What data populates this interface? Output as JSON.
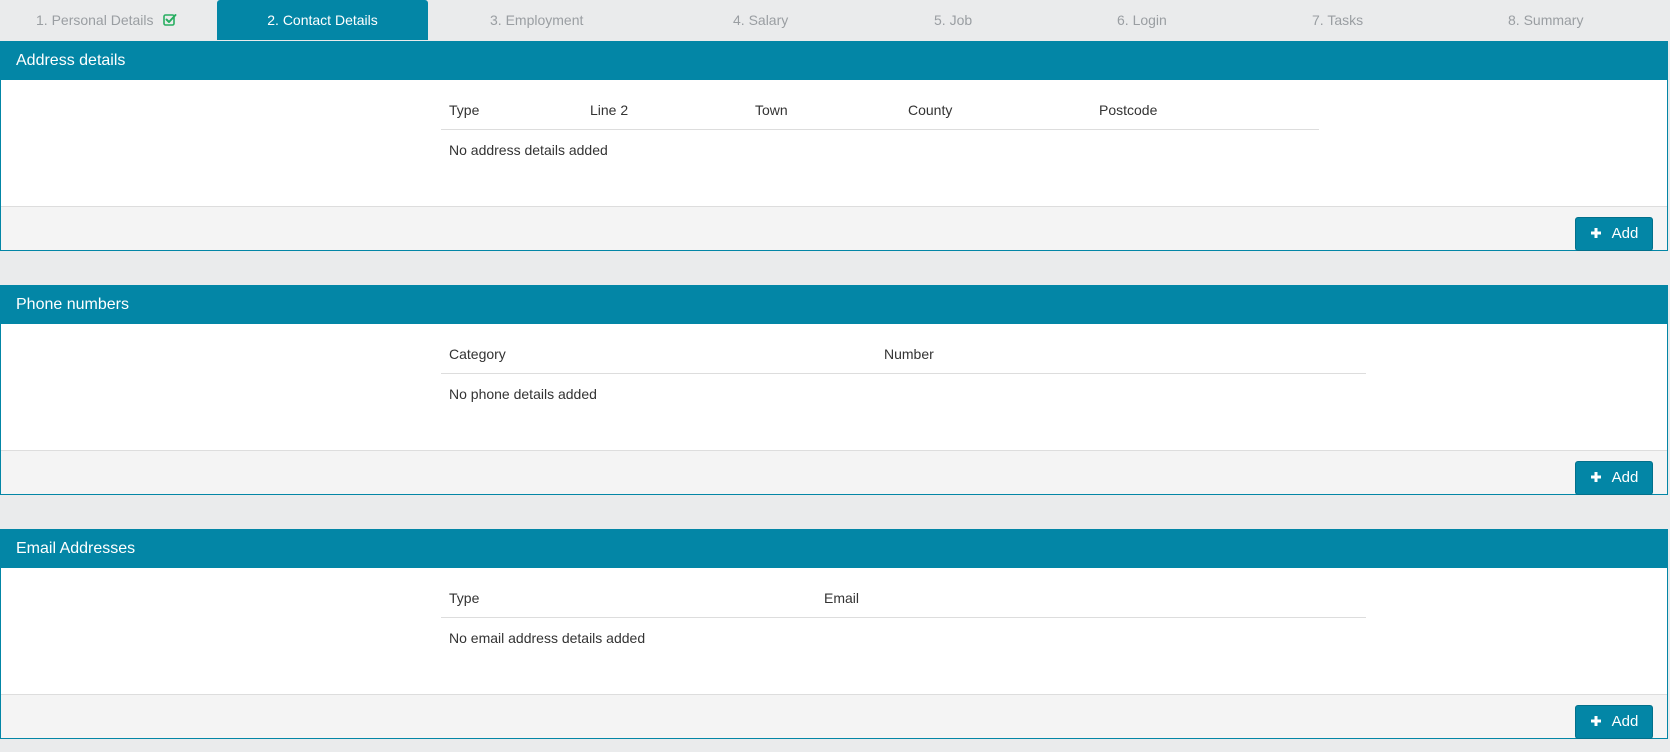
{
  "wizard": {
    "tabs": [
      {
        "label": "1. Personal Details",
        "completed": true,
        "active": false
      },
      {
        "label": "2. Contact Details",
        "completed": false,
        "active": true
      },
      {
        "label": "3. Employment",
        "completed": false,
        "active": false
      },
      {
        "label": "4. Salary",
        "completed": false,
        "active": false
      },
      {
        "label": "5. Job",
        "completed": false,
        "active": false
      },
      {
        "label": "6. Login",
        "completed": false,
        "active": false
      },
      {
        "label": "7. Tasks",
        "completed": false,
        "active": false
      },
      {
        "label": "8. Summary",
        "completed": false,
        "active": false
      }
    ]
  },
  "address": {
    "title": "Address details",
    "columns": [
      "Type",
      "Line 2",
      "Town",
      "County",
      "Postcode"
    ],
    "empty_text": "No address details added",
    "add_label": "Add"
  },
  "phone": {
    "title": "Phone numbers",
    "columns": [
      "Category",
      "Number"
    ],
    "empty_text": "No phone details added",
    "add_label": "Add"
  },
  "email": {
    "title": "Email Addresses",
    "columns": [
      "Type",
      "Email"
    ],
    "empty_text": "No email address details added",
    "add_label": "Add"
  },
  "colors": {
    "accent": "#0386a6",
    "completed_check": "#27ae60",
    "tab_inactive_text": "#9a9ea2",
    "page_background": "#eaebec",
    "footer_background": "#f4f4f4"
  },
  "icons": {
    "completed": "check-square-icon",
    "add": "plus-icon"
  }
}
